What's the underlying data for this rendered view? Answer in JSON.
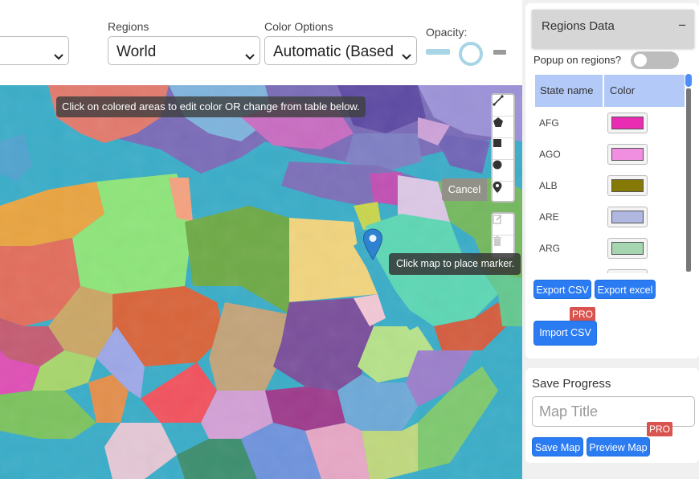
{
  "toolbar": {
    "regions_label": "Regions",
    "regions_value": "World",
    "color_label": "Color Options",
    "color_value": "Automatic (Based",
    "opacity_label": "Opacity:"
  },
  "map": {
    "hint_tooltip": "Click on colored areas to edit color OR change from table below.",
    "cancel_label": "Cancel",
    "marker_tooltip": "Click map to place marker.",
    "draw_tools": [
      "polyline-icon",
      "polygon-icon",
      "rectangle-icon",
      "circle-icon",
      "marker-icon"
    ],
    "edit_tools": [
      "edit-layers-icon",
      "delete-layers-icon"
    ]
  },
  "regions_panel": {
    "title": "Regions Data",
    "toggle_symbol": "−",
    "popup_label": "Popup on regions?",
    "popup_enabled": false,
    "columns": [
      "State name",
      "Color"
    ],
    "rows": [
      {
        "code": "AFG",
        "color": "#ea2cb2"
      },
      {
        "code": "AGO",
        "color": "#f08fe0"
      },
      {
        "code": "ALB",
        "color": "#867a06"
      },
      {
        "code": "ARE",
        "color": "#b0b8e2"
      },
      {
        "code": "ARG",
        "color": "#a6d6b0"
      }
    ],
    "export_csv": "Export CSV",
    "export_excel": "Export excel",
    "import_csv": "Import CSV",
    "pro_badge": "PRO"
  },
  "save_panel": {
    "title": "Save Progress",
    "map_title_placeholder": "Map Title",
    "save_map": "Save Map",
    "preview_map": "Preview Map",
    "pro_badge": "PRO"
  },
  "colors": {
    "accent": "#2b7bf2",
    "pro": "#d9534f",
    "table_header": "#b3c9f7",
    "sea": "#35a8c5"
  }
}
